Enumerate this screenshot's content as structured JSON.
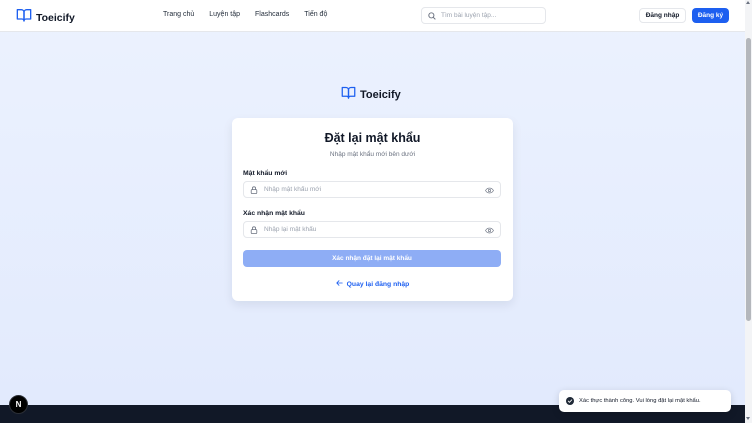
{
  "header": {
    "logo_text": "Toeicify",
    "nav": [
      "Trang chủ",
      "Luyện tập",
      "Flashcards",
      "Tiến độ"
    ],
    "search_placeholder": "Tìm bài luyện tập...",
    "login_label": "Đăng nhập",
    "register_label": "Đăng ký"
  },
  "brand": {
    "name": "Toeicify",
    "icon": "book-open-icon"
  },
  "form": {
    "title": "Đặt lại mật khẩu",
    "subtitle": "Nhập mật khẩu mới bên dưới",
    "new_password": {
      "label": "Mật khẩu mới",
      "placeholder": "Nhập mật khẩu mới",
      "value": ""
    },
    "confirm_password": {
      "label": "Xác nhận mật khẩu",
      "placeholder": "Nhập lại mật khẩu",
      "value": ""
    },
    "submit_label": "Xác nhận đặt lại mật khẩu",
    "back_label": "Quay lại đăng nhập"
  },
  "toast": {
    "message": "Xác thực thành công. Vui lòng đặt lại mật khẩu.",
    "icon": "check-circle-icon"
  },
  "dev_badge": {
    "label": "N"
  },
  "colors": {
    "accent": "#1d5ff0",
    "submit_disabled": "#8eadf5",
    "background": "#e3ecfd"
  }
}
